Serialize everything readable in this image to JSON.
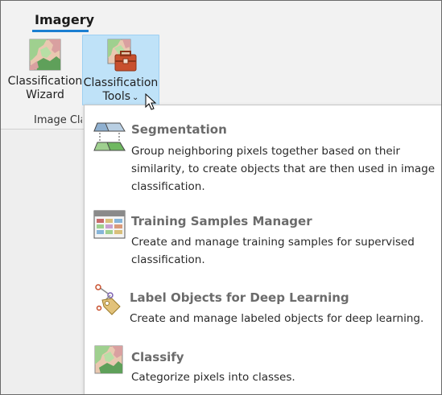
{
  "ribbon": {
    "tab_label": "Imagery",
    "group_label": "Image Cla",
    "buttons": {
      "wizard": {
        "line1": "Classification",
        "line2": "Wizard"
      },
      "tools": {
        "line1": "Classification",
        "line2": "Tools",
        "dropdown_glyph": "⌄"
      }
    },
    "colors": {
      "tab_underline": "#1b7fd1",
      "active_button": "#bfe2f8"
    }
  },
  "menu": {
    "items": [
      {
        "title": "Segmentation",
        "description": "Group neighboring pixels together based on their similarity, to create objects that are then used in image classification.",
        "icon": "segmentation-icon"
      },
      {
        "title": "Training Samples Manager",
        "description": "Create and manage training samples for supervised classification.",
        "icon": "training-samples-table-icon"
      },
      {
        "title": "Label Objects for Deep Learning",
        "description": "Create and manage labeled objects for deep learning.",
        "icon": "label-tag-icon"
      },
      {
        "title": "Classify",
        "description": "Categorize pixels into classes.",
        "icon": "classify-map-icon"
      }
    ]
  }
}
